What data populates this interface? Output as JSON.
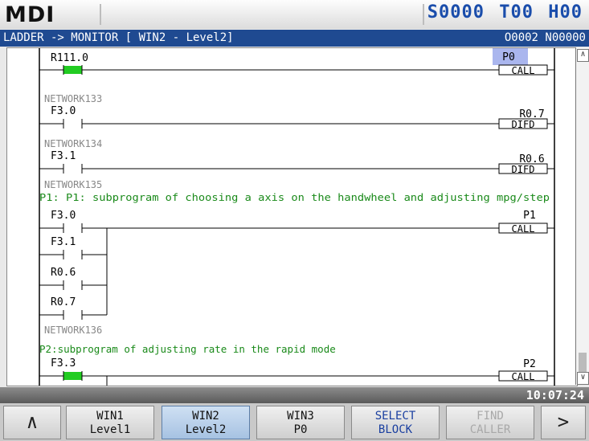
{
  "header": {
    "mode": "MDI",
    "spindle": "S0000",
    "tool": "T00",
    "h_offset": "H00"
  },
  "title": {
    "text": "LADDER -> MONITOR [ WIN2 - Level2]",
    "program": "O0002 N00000"
  },
  "ladder": {
    "rungs": [
      {
        "contacts": [
          {
            "address": "R111.0",
            "state": "on"
          }
        ],
        "coil": {
          "address": "P0",
          "type": "CALL",
          "highlight": true
        }
      },
      {
        "network": "NETWORK133",
        "contacts": [
          {
            "address": "F3.0",
            "state": "off"
          }
        ],
        "coil": {
          "address": "R0.7",
          "type": "DIFD"
        }
      },
      {
        "network": "NETWORK134",
        "contacts": [
          {
            "address": "F3.1",
            "state": "off"
          }
        ],
        "coil": {
          "address": "R0.6",
          "type": "DIFD"
        }
      },
      {
        "network": "NETWORK135",
        "comment": "P1: P1: subprogram of choosing a axis on the handwheel  and adjusting mpg/step",
        "contacts": [
          {
            "address": "F3.0",
            "state": "off"
          },
          {
            "address": "F3.1",
            "state": "off"
          },
          {
            "address": "R0.6",
            "state": "off"
          },
          {
            "address": "R0.7",
            "state": "off"
          }
        ],
        "coil": {
          "address": "P1",
          "type": "CALL"
        }
      },
      {
        "network": "NETWORK136",
        "comment": "P2:subprogram of adjusting rate in the rapid mode",
        "contacts": [
          {
            "address": "F3.3",
            "state": "on"
          }
        ],
        "coil": {
          "address": "P2",
          "type": "CALL"
        }
      }
    ]
  },
  "status": {
    "time": "10:07:24"
  },
  "softkeys": {
    "back_icon": "chevron-up-icon",
    "win1": [
      "WIN1",
      "Level1"
    ],
    "win2": [
      "WIN2",
      "Level2"
    ],
    "win3": [
      "WIN3",
      "P0"
    ],
    "select_block": [
      "SELECT",
      "BLOCK"
    ],
    "find_caller": [
      "FIND",
      "CALLER"
    ],
    "next_icon": "chevron-right-icon"
  },
  "colors": {
    "title_bg": "#1f4a91",
    "active_contact": "#22cc22",
    "comment": "#1a8a1a",
    "header_status": "#1a4dab",
    "active_softkey": "#a6c2e2"
  }
}
